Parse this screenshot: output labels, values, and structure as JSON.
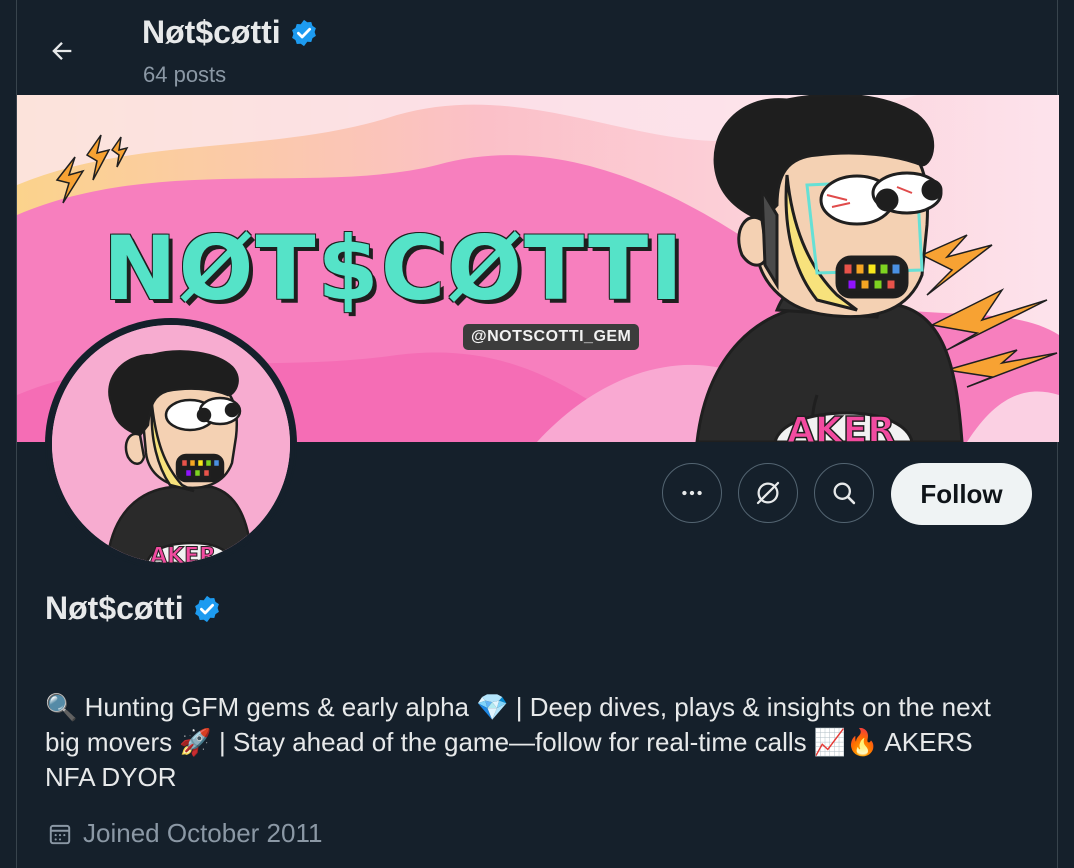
{
  "header": {
    "title": "Nøt$cøtti",
    "posts_count": "64 posts"
  },
  "banner": {
    "headline": "NØT$CØTTI",
    "handle_tag": "@NOTSCOTTI_GEM",
    "shirt_text": "AKER"
  },
  "avatar": {
    "shirt_text": "AKER"
  },
  "actions": {
    "follow_label": "Follow"
  },
  "profile": {
    "display_name": "Nøt$cøtti",
    "bio": "🔍 Hunting GFM gems & early alpha 💎 | Deep dives, plays & insights on the next big movers 🚀 | Stay ahead of the game—follow for real-time calls 📈🔥 AKERS NFA DYOR",
    "joined": "Joined October 2011"
  },
  "colors": {
    "background": "#15202b",
    "verified": "#1d9bf0",
    "banner_pink": "#f9b9d9",
    "banner_text": "#55e3c8"
  }
}
